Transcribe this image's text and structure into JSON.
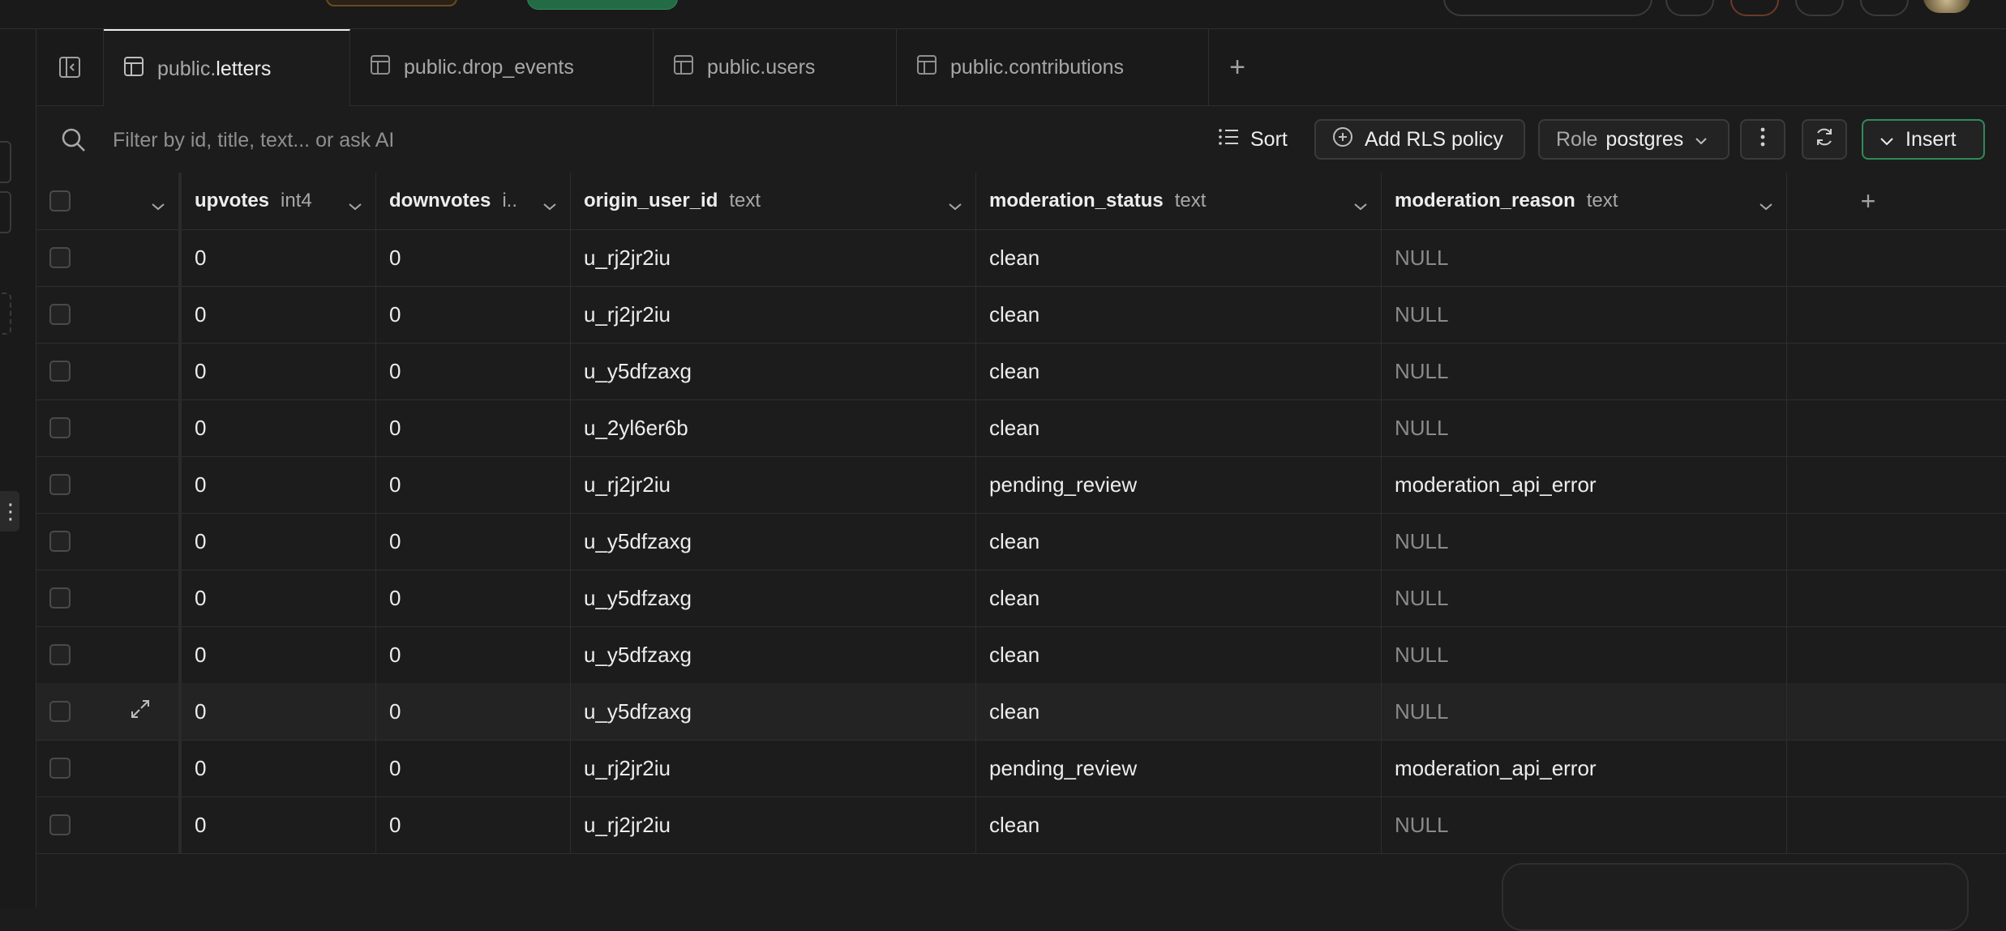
{
  "tabs": [
    {
      "schema": "public.",
      "table": "letters",
      "active": true
    },
    {
      "schema": "public.",
      "table": "drop_events",
      "active": false
    },
    {
      "schema": "public.",
      "table": "users",
      "active": false
    },
    {
      "schema": "public.",
      "table": "contributions",
      "active": false
    }
  ],
  "toolbar": {
    "filter_placeholder": "Filter by id, title, text... or ask AI",
    "sort_label": "Sort",
    "rls_label": "Add RLS policy",
    "role_prefix": "Role",
    "role_value": "postgres",
    "insert_label": "Insert"
  },
  "columns": [
    {
      "name": "upvotes",
      "type": "int4"
    },
    {
      "name": "downvotes",
      "type": "i.."
    },
    {
      "name": "origin_user_id",
      "type": "text"
    },
    {
      "name": "moderation_status",
      "type": "text"
    },
    {
      "name": "moderation_reason",
      "type": "text"
    }
  ],
  "rows": [
    {
      "upvotes": "0",
      "downvotes": "0",
      "origin_user_id": "u_rj2jr2iu",
      "moderation_status": "clean",
      "moderation_reason": "NULL"
    },
    {
      "upvotes": "0",
      "downvotes": "0",
      "origin_user_id": "u_rj2jr2iu",
      "moderation_status": "clean",
      "moderation_reason": "NULL"
    },
    {
      "upvotes": "0",
      "downvotes": "0",
      "origin_user_id": "u_y5dfzaxg",
      "moderation_status": "clean",
      "moderation_reason": "NULL"
    },
    {
      "upvotes": "0",
      "downvotes": "0",
      "origin_user_id": "u_2yl6er6b",
      "moderation_status": "clean",
      "moderation_reason": "NULL"
    },
    {
      "upvotes": "0",
      "downvotes": "0",
      "origin_user_id": "u_rj2jr2iu",
      "moderation_status": "pending_review",
      "moderation_reason": "moderation_api_error"
    },
    {
      "upvotes": "0",
      "downvotes": "0",
      "origin_user_id": "u_y5dfzaxg",
      "moderation_status": "clean",
      "moderation_reason": "NULL"
    },
    {
      "upvotes": "0",
      "downvotes": "0",
      "origin_user_id": "u_y5dfzaxg",
      "moderation_status": "clean",
      "moderation_reason": "NULL"
    },
    {
      "upvotes": "0",
      "downvotes": "0",
      "origin_user_id": "u_y5dfzaxg",
      "moderation_status": "clean",
      "moderation_reason": "NULL"
    },
    {
      "upvotes": "0",
      "downvotes": "0",
      "origin_user_id": "u_y5dfzaxg",
      "moderation_status": "clean",
      "moderation_reason": "NULL"
    },
    {
      "upvotes": "0",
      "downvotes": "0",
      "origin_user_id": "u_rj2jr2iu",
      "moderation_status": "pending_review",
      "moderation_reason": "moderation_api_error"
    },
    {
      "upvotes": "0",
      "downvotes": "0",
      "origin_user_id": "u_rj2jr2iu",
      "moderation_status": "clean",
      "moderation_reason": "NULL"
    }
  ],
  "colors": {
    "accent": "#236b45",
    "background": "#1c1c1c",
    "border": "#2e2e2e",
    "null_text": "#8a8a8a"
  },
  "icons": [
    "search-icon",
    "sort-icon",
    "plus-circle-icon",
    "chevron-down-icon",
    "more-vertical-icon",
    "refresh-icon",
    "table-icon",
    "expand-icon",
    "sidebar-collapse-icon",
    "plus-icon"
  ]
}
